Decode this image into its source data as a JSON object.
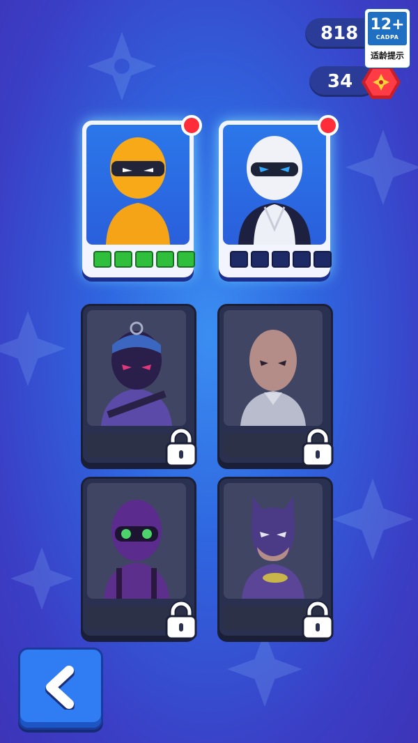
{
  "currency": {
    "coins": "818",
    "shuriken": "34"
  },
  "age_rating": {
    "rating": "12+",
    "org": "CADPA",
    "label": "适龄提示"
  },
  "characters": [
    {
      "name": "orange-ninja",
      "locked": false,
      "new": true,
      "progress": 5,
      "max": 5
    },
    {
      "name": "white-ninja",
      "locked": false,
      "new": true,
      "progress": 0,
      "max": 5
    },
    {
      "name": "blue-hooded-ninja",
      "locked": true
    },
    {
      "name": "bald-man",
      "locked": true
    },
    {
      "name": "purple-goggles-ninja",
      "locked": true
    },
    {
      "name": "bat-hero",
      "locked": true
    }
  ],
  "colors": {
    "progress_filled": "#2fbf3c",
    "progress_empty": "#1d2a66",
    "badge": "#ff2d3a"
  },
  "back_button": {
    "icon": "chevron-left-icon"
  }
}
